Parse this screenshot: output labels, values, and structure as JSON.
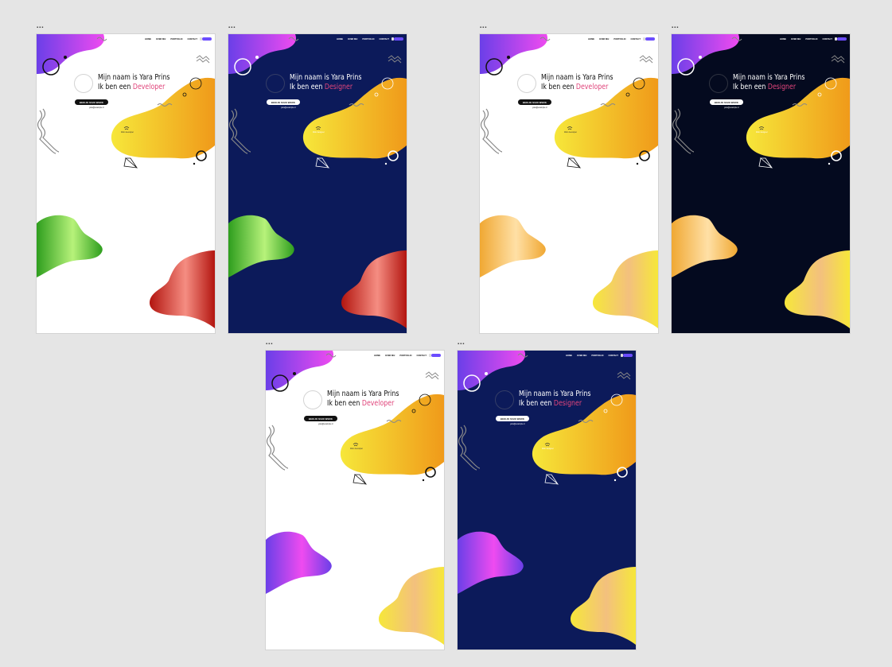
{
  "canvas": {
    "background": "#e5e5e5"
  },
  "frames": [
    {
      "id": "f1",
      "label": "▪▪▪",
      "theme": "light",
      "nav": [
        "HOME",
        "OVER MIJ",
        "PORTFOLIO",
        "CONTACT"
      ],
      "intro_prefix": "Mijn naam is Yara Prins",
      "role_prefix": "Ik ben een",
      "role": "Developer",
      "cta_label": "BEKIJK MIJN WERK",
      "contact": "yara@example.nl",
      "blob_text": "Web developer",
      "bottom_left_colors": [
        "#2e9e1e",
        "#b7f27a"
      ],
      "bottom_right_colors": [
        "#b3150f",
        "#f58d82"
      ]
    },
    {
      "id": "f2",
      "label": "▪▪▪",
      "theme": "navy",
      "nav": [
        "HOME",
        "OVER MIJ",
        "PORTFOLIO",
        "CONTACT"
      ],
      "intro_prefix": "Mijn naam is Yara Prins",
      "role_prefix": "Ik ben een",
      "role": "Designer",
      "cta_label": "BEKIJK MIJN WERK",
      "contact": "yara@example.nl",
      "blob_text": "Web designer",
      "bottom_left_colors": [
        "#2e9e1e",
        "#b7f27a"
      ],
      "bottom_right_colors": [
        "#b3150f",
        "#f58d82"
      ]
    },
    {
      "id": "f3",
      "label": "▪▪▪",
      "theme": "light",
      "nav": [
        "HOME",
        "OVER MIJ",
        "PORTFOLIO",
        "CONTACT"
      ],
      "intro_prefix": "Mijn naam is Yara Prins",
      "role_prefix": "Ik ben een",
      "role": "Developer",
      "cta_label": "BEKIJK MIJN WERK",
      "contact": "yara@example.nl",
      "blob_text": "Web developer",
      "bottom_left_colors": [
        "#f0a833",
        "#ffe0a6"
      ],
      "bottom_right_colors": [
        "#f6e73a",
        "#f3c07e"
      ]
    },
    {
      "id": "f4",
      "label": "▪▪▪",
      "theme": "black",
      "nav": [
        "HOME",
        "OVER MIJ",
        "PORTFOLIO",
        "CONTACT"
      ],
      "intro_prefix": "Mijn naam is Yara Prins",
      "role_prefix": "Ik ben een",
      "role": "Designer",
      "cta_label": "BEKIJK MIJN WERK",
      "contact": "yara@example.nl",
      "blob_text": "Web designer",
      "bottom_left_colors": [
        "#f0a833",
        "#ffe0a6"
      ],
      "bottom_right_colors": [
        "#f6e73a",
        "#f3c07e"
      ]
    },
    {
      "id": "f5",
      "label": "▪▪▪",
      "theme": "light",
      "nav": [
        "HOME",
        "OVER MIJ",
        "PORTFOLIO",
        "CONTACT"
      ],
      "intro_prefix": "Mijn naam is Yara Prins",
      "role_prefix": "Ik ben een",
      "role": "Developer",
      "cta_label": "BEKIJK MIJN WERK",
      "contact": "yara@example.nl",
      "blob_text": "Web developer",
      "bottom_left_colors": [
        "#6b3fe8",
        "#ef4bf0"
      ],
      "bottom_right_colors": [
        "#f6e73a",
        "#f3c07e"
      ]
    },
    {
      "id": "f6",
      "label": "▪▪▪",
      "theme": "navy",
      "nav": [
        "HOME",
        "OVER MIJ",
        "PORTFOLIO",
        "CONTACT"
      ],
      "intro_prefix": "Mijn naam is Yara Prins",
      "role_prefix": "Ik ben een",
      "role": "Designer",
      "cta_label": "BEKIJK MIJN WERK",
      "contact": "yara@example.nl",
      "blob_text": "Web designer",
      "bottom_left_colors": [
        "#6b3fe8",
        "#ef4bf0"
      ],
      "bottom_right_colors": [
        "#f6e73a",
        "#f3c07e"
      ]
    }
  ],
  "colors": {
    "accent_role": "#e0457b",
    "top_blob": [
      "#6b3fe8",
      "#ef4bf0"
    ],
    "main_blob": [
      "#f6e73a",
      "#f09a1a"
    ]
  }
}
